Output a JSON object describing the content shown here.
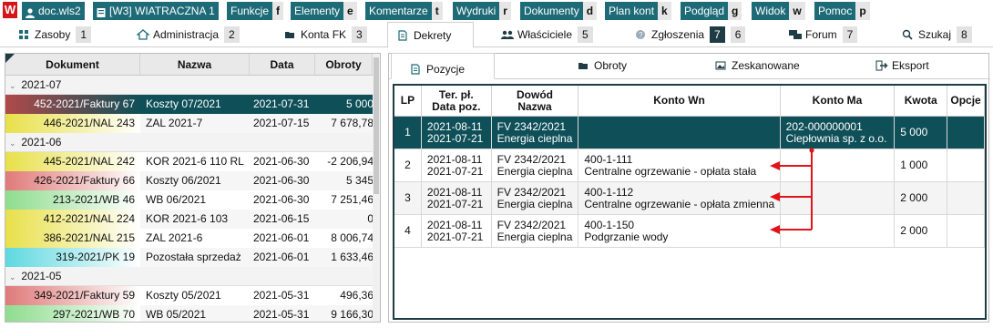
{
  "topbar": {
    "logo": "W",
    "user": "doc.wls2",
    "db": "[W3] WIATRACZNA 1",
    "menu": [
      {
        "label": "Funkcje",
        "key": "f"
      },
      {
        "label": "Elementy",
        "key": "e"
      },
      {
        "label": "Komentarze",
        "key": "t"
      },
      {
        "label": "Wydruki",
        "key": "r"
      },
      {
        "label": "Dokumenty",
        "key": "d"
      },
      {
        "label": "Plan kont",
        "key": "k"
      },
      {
        "label": "Podgląd",
        "key": "g"
      },
      {
        "label": "Widok",
        "key": "w"
      },
      {
        "label": "Pomoc",
        "key": "p"
      }
    ]
  },
  "nav": [
    {
      "label": "Zasoby",
      "badge": "1"
    },
    {
      "label": "Administracja",
      "badge": "2"
    },
    {
      "label": "Konta FK",
      "badge": "3"
    },
    {
      "label": "Dekrety",
      "badge": ""
    },
    {
      "label": "Właściciele",
      "badge": "5"
    },
    {
      "label": "Zgłoszenia",
      "badge": "7",
      "badge2": "6"
    },
    {
      "label": "Forum",
      "badge": "7"
    },
    {
      "label": "Szukaj",
      "badge": "8"
    }
  ],
  "left": {
    "headers": [
      "Dokument",
      "Nazwa",
      "Data",
      "Obroty"
    ],
    "groups": [
      {
        "name": "2021-07",
        "rows": [
          {
            "doc": "452-2021/Faktury 67",
            "name": "Koszty 07/2021",
            "date": "2021-07-31",
            "amount": "5 000",
            "color": "#b04a4a",
            "selected": true
          },
          {
            "doc": "446-2021/NAL 243",
            "name": "ZAL 2021-7",
            "date": "2021-07-15",
            "amount": "7 678,78",
            "color": "#e8e04a"
          }
        ]
      },
      {
        "name": "2021-06",
        "rows": [
          {
            "doc": "445-2021/NAL 242",
            "name": "KOR 2021-6 110 RL",
            "date": "2021-06-30",
            "amount": "-2 206,94",
            "color": "#e8e04a"
          },
          {
            "doc": "426-2021/Faktury 66",
            "name": "Koszty 06/2021",
            "date": "2021-06-30",
            "amount": "5 345",
            "color": "#e07a7a"
          },
          {
            "doc": "213-2021/WB 46",
            "name": "WB 06/2021",
            "date": "2021-06-30",
            "amount": "7 251,46",
            "color": "#8fdc8f"
          },
          {
            "doc": "412-2021/NAL 224",
            "name": "KOR 2021-6 103",
            "date": "2021-06-15",
            "amount": "0",
            "color": "#e8e04a"
          },
          {
            "doc": "386-2021/NAL 215",
            "name": "ZAL 2021-6",
            "date": "2021-06-01",
            "amount": "8 006,74",
            "color": "#e8e04a"
          },
          {
            "doc": "319-2021/PK 19",
            "name": "Pozostała sprzedaż",
            "date": "2021-06-01",
            "amount": "1 633,46",
            "color": "#5fd8e0"
          }
        ]
      },
      {
        "name": "2021-05",
        "rows": [
          {
            "doc": "349-2021/Faktury 59",
            "name": "Koszty 05/2021",
            "date": "2021-05-31",
            "amount": "496,36",
            "color": "#e07a7a"
          },
          {
            "doc": "297-2021/WB 70",
            "name": "WB 05/2021",
            "date": "2021-05-31",
            "amount": "9 166,30",
            "color": "#8fdc8f"
          }
        ]
      }
    ]
  },
  "right": {
    "tabs": [
      "Pozycje",
      "Obroty",
      "Zeskanowane",
      "Eksport"
    ],
    "headers": {
      "lp": "LP",
      "dates": [
        "Ter. pł.",
        "Data poz."
      ],
      "proof": [
        "Dowód",
        "Nazwa"
      ],
      "wn": "Konto Wn",
      "ma": "Konto Ma",
      "amount": "Kwota",
      "options": "Opcje"
    },
    "rows": [
      {
        "lp": "1",
        "d1": "2021-08-11",
        "d2": "2021-07-21",
        "p1": "FV 2342/2021",
        "p2": "Energia cieplna",
        "wn1": "",
        "wn2": "",
        "ma1": "202-000000001",
        "ma2": "Ciepłownia sp. z o.o.",
        "amount": "5 000"
      },
      {
        "lp": "2",
        "d1": "2021-08-11",
        "d2": "2021-07-21",
        "p1": "FV 2342/2021",
        "p2": "Energia cieplna",
        "wn1": "400-1-111",
        "wn2": "Centralne ogrzewanie - opłata stała",
        "ma1": "",
        "ma2": "",
        "amount": "1 000"
      },
      {
        "lp": "3",
        "d1": "2021-08-11",
        "d2": "2021-07-21",
        "p1": "FV 2342/2021",
        "p2": "Energia cieplna",
        "wn1": "400-1-112",
        "wn2": "Centralne ogrzewanie - opłata zmienna",
        "ma1": "",
        "ma2": "",
        "amount": "2 000"
      },
      {
        "lp": "4",
        "d1": "2021-08-11",
        "d2": "2021-07-21",
        "p1": "FV 2342/2021",
        "p2": "Energia cieplna",
        "wn1": "400-1-150",
        "wn2": "Podgrzanie wody",
        "ma1": "",
        "ma2": "",
        "amount": "2 000"
      }
    ]
  },
  "colors": {
    "accent": "#1e6b78",
    "selected": "#0f4f58",
    "arrow": "#e0141b"
  }
}
